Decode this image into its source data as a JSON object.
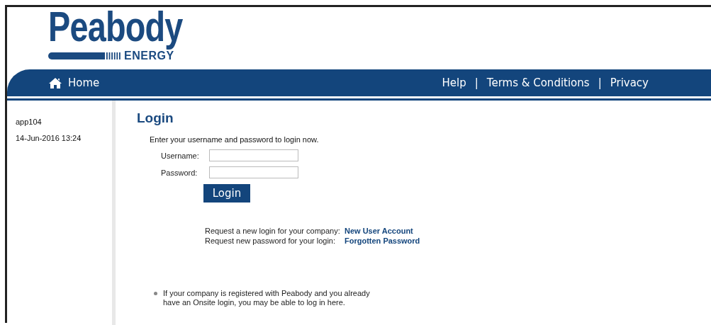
{
  "logo": {
    "name": "Peabody",
    "tagline": "ENERGY"
  },
  "nav": {
    "home": "Home",
    "links": [
      "Help",
      "Terms & Conditions",
      "Privacy"
    ],
    "separator": "|"
  },
  "sidebar": {
    "items": [
      "app104",
      "14-Jun-2016 13:24"
    ]
  },
  "login": {
    "title": "Login",
    "intro": "Enter your username and password to login now.",
    "fields": [
      {
        "label": "Username:"
      },
      {
        "label": "Password:"
      }
    ],
    "button": "Login",
    "requests": [
      {
        "text": "Request a new login for your company:",
        "link": "New User Account"
      },
      {
        "text": "Request new password for your login:",
        "link": "Forgotten Password"
      }
    ],
    "notes": [
      "If your company is registered with Peabody and you already have an Onsite login, you may be able to log in here."
    ]
  }
}
